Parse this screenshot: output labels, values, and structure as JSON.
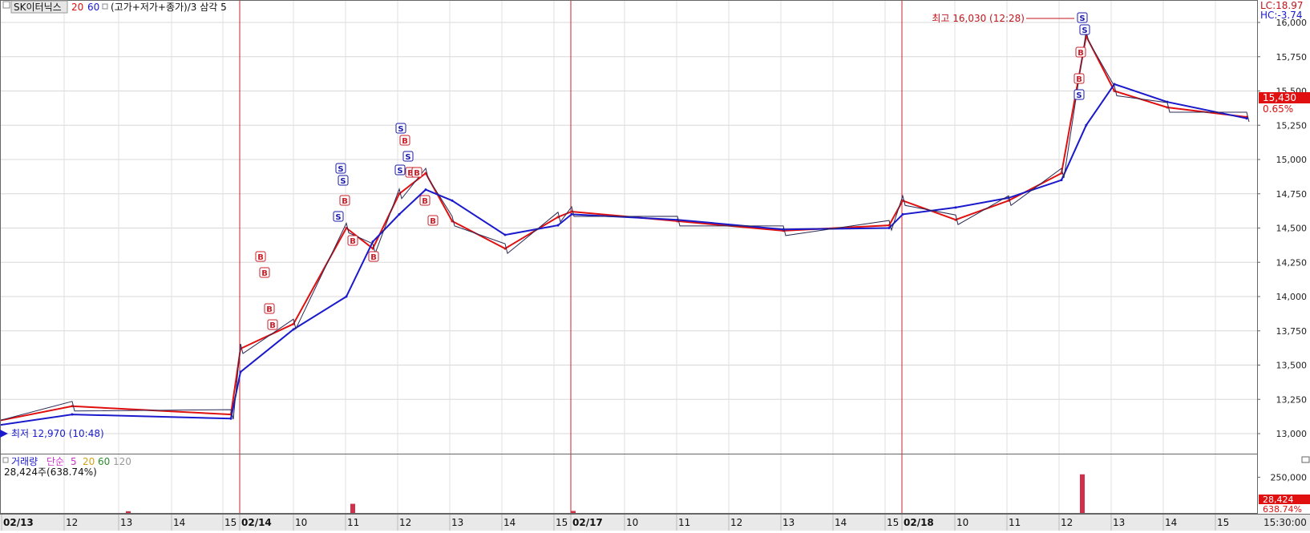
{
  "header": {
    "symbol": "SK이터닉스",
    "ma_periods": [
      "20",
      "60"
    ],
    "ma_colors": [
      "#e01010",
      "#1a1acc"
    ],
    "formula": "(고가+저가+종가)/3 삼각 5"
  },
  "right_top": {
    "lc": "LC:18.97",
    "hc": "HC:-3.74",
    "price_badge": "15,430",
    "change_badge": "0.65%",
    "price_badge_color": "#e01010"
  },
  "annotations": {
    "high": "최고 16,030 (12:28)",
    "low": "최저 12,970 (10:48)"
  },
  "volume_header": {
    "title": "거래량",
    "ma_type": "단순",
    "periods": [
      "5",
      "20",
      "60",
      "120"
    ],
    "period_colors": [
      "#cc33cc",
      "#d4a017",
      "#2e8b2e",
      "#999999"
    ],
    "value": "28,424주(638.74%)"
  },
  "volume_badges": {
    "value": "28,424",
    "pct": "638.74%"
  },
  "time_axis": {
    "labels": [
      "02/13",
      "12",
      "13",
      "14",
      "15",
      "02/14",
      "10",
      "11",
      "12",
      "13",
      "14",
      "15",
      "02/17",
      "10",
      "11",
      "12",
      "13",
      "14",
      "15",
      "02/18",
      "10",
      "11",
      "12",
      "13",
      "14",
      "15"
    ],
    "end_time": "15:30:00"
  },
  "chart_data": [
    {
      "type": "line",
      "title": "SK이터닉스",
      "subtitle": "(고가+저가+종가)/3 삼각 5",
      "y_tick_labels": [
        "16,000",
        "15,750",
        "15,500",
        "15,250",
        "15,000",
        "14,750",
        "14,500",
        "14,250",
        "14,000",
        "13,750",
        "13,500",
        "13,250",
        "13,000"
      ],
      "ylim": [
        12900,
        16060
      ],
      "x": [
        "02/13 09:00",
        "02/13 12:00",
        "02/13 15:00",
        "02/14 09:00",
        "02/14 10:00",
        "02/14 11:00",
        "02/14 11:30",
        "02/14 12:00",
        "02/14 12:30",
        "02/14 13:00",
        "02/14 14:00",
        "02/14 15:00",
        "02/17 09:00",
        "02/17 11:00",
        "02/17 13:00",
        "02/17 15:00",
        "02/18 09:00",
        "02/18 10:00",
        "02/18 11:00",
        "02/18 12:00",
        "02/18 12:28",
        "02/18 13:00",
        "02/18 14:00",
        "02/18 15:30"
      ],
      "series": [
        {
          "name": "20",
          "values": [
            12970,
            13200,
            13140,
            13620,
            13800,
            14500,
            14350,
            14750,
            14900,
            14550,
            14350,
            14580,
            14620,
            14550,
            14480,
            14520,
            14700,
            14560,
            14700,
            14900,
            15900,
            15500,
            15380,
            15310
          ]
        },
        {
          "name": "60",
          "values": [
            12970,
            13140,
            13110,
            13450,
            13760,
            14000,
            14400,
            14600,
            14780,
            14700,
            14450,
            14520,
            14600,
            14560,
            14490,
            14500,
            14600,
            14650,
            14720,
            14850,
            15250,
            15550,
            15420,
            15300
          ]
        }
      ],
      "annotations": [
        "최고 16,030 (12:28)",
        "최저 12,970 (10:48)"
      ],
      "buy_sell_markers": "B / S"
    },
    {
      "type": "bar",
      "title": "거래량",
      "y_tick_labels": [
        "250,000"
      ],
      "ylim": [
        0,
        280000
      ],
      "x": [
        "02/13",
        "02/14",
        "02/17",
        "02/18"
      ],
      "values": [
        12000,
        64000,
        14000,
        270000
      ]
    }
  ]
}
